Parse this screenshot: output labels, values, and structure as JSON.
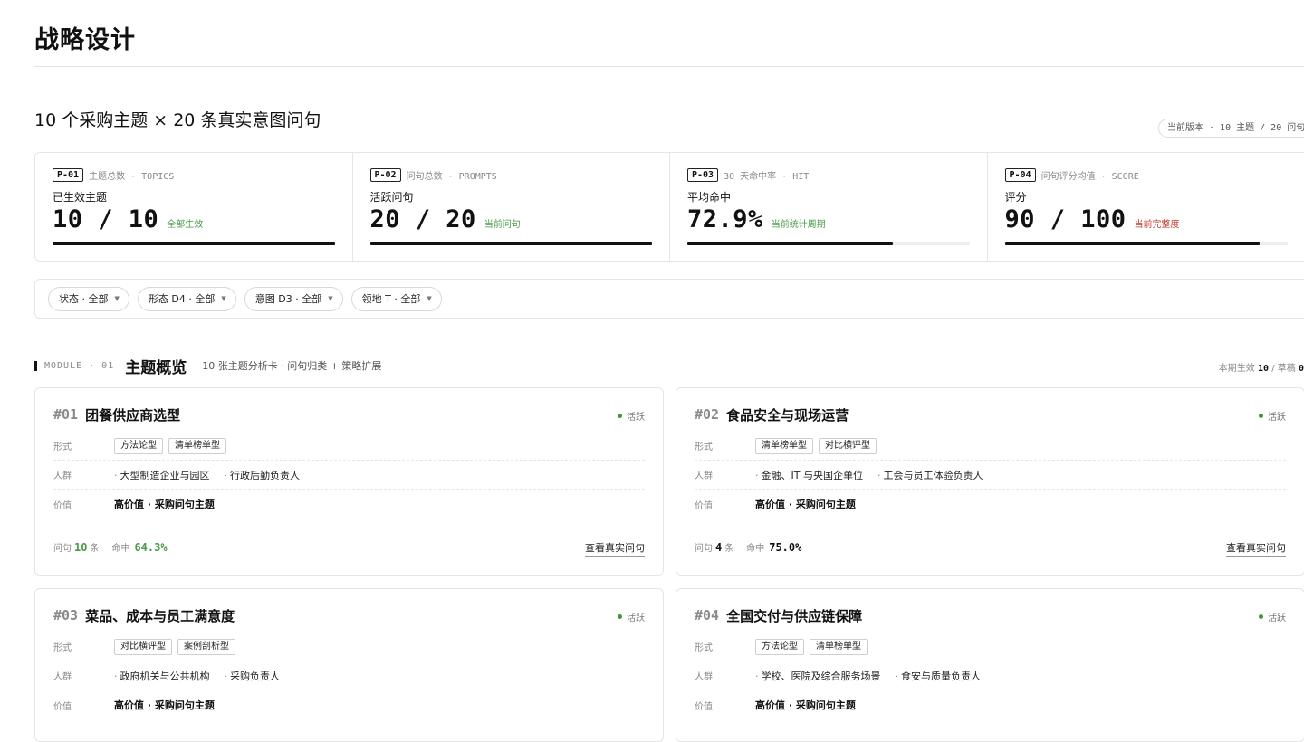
{
  "page": {
    "title": "战略设计"
  },
  "section": {
    "title": "10 个采购主题 × 20 条真实意图问句",
    "version_pill": "当前版本 · 10 主题 / 20 问句"
  },
  "stats": [
    {
      "code": "P-01",
      "caption": "主题总数 · TOPICS",
      "label": "已生效主题",
      "value": "10 / 10",
      "note": "全部生效",
      "note_color": "#4a9a4a",
      "progress": 1.0
    },
    {
      "code": "P-02",
      "caption": "问句总数 · PROMPTS",
      "label": "活跃问句",
      "value": "20 / 20",
      "note": "当前问句",
      "note_color": "#4a9a4a",
      "progress": 1.0
    },
    {
      "code": "P-03",
      "caption": "30 天命中率 · HIT",
      "label": "平均命中",
      "value": "72.9%",
      "note": "当前统计周期",
      "note_color": "#4a9a4a",
      "progress": 0.729
    },
    {
      "code": "P-04",
      "caption": "问句评分均值 · SCORE",
      "label": "评分",
      "value": "90 / 100",
      "note": "当前完整度",
      "note_color": "#c0392b",
      "progress": 0.9
    }
  ],
  "filters": [
    {
      "label": "状态 · 全部"
    },
    {
      "label": "形态 D4 · 全部"
    },
    {
      "label": "意图 D3 · 全部"
    },
    {
      "label": "领地 T · 全部"
    }
  ],
  "module": {
    "code": "MODULE · 01",
    "title": "主题概览",
    "desc": "10 张主题分析卡 · 问句归类 + 策略扩展",
    "right_prefix": "本期生效",
    "right_active": "10",
    "right_sep": "/ 草稿",
    "right_draft": "0"
  },
  "labels": {
    "form": "形式",
    "crowd": "人群",
    "value": "价值",
    "prompts": "问句",
    "unit": "条",
    "hit": "命中",
    "view": "查看真实问句"
  },
  "cards": [
    {
      "num": "#01",
      "title": "团餐供应商选型",
      "status": "活跃",
      "tags": [
        "方法论型",
        "清单榜单型"
      ],
      "crowd": [
        "大型制造企业与园区",
        "行政后勤负责人"
      ],
      "value": "高价值 · 采购问句主题",
      "prompts": "10",
      "hit": "64.3%",
      "highlight": true
    },
    {
      "num": "#02",
      "title": "食品安全与现场运营",
      "status": "活跃",
      "tags": [
        "清单榜单型",
        "对比横评型"
      ],
      "crowd": [
        "金融、IT 与央国企单位",
        "工会与员工体验负责人"
      ],
      "value": "高价值 · 采购问句主题",
      "prompts": "4",
      "hit": "75.0%",
      "highlight": false
    },
    {
      "num": "#03",
      "title": "菜品、成本与员工满意度",
      "status": "活跃",
      "tags": [
        "对比横评型",
        "案例剖析型"
      ],
      "crowd": [
        "政府机关与公共机构",
        "采购负责人"
      ],
      "value": "高价值 · 采购问句主题"
    },
    {
      "num": "#04",
      "title": "全国交付与供应链保障",
      "status": "活跃",
      "tags": [
        "方法论型",
        "清单榜单型"
      ],
      "crowd": [
        "学校、医院及综合服务场景",
        "食安与质量负责人"
      ],
      "value": "高价值 · 采购问句主题"
    }
  ]
}
